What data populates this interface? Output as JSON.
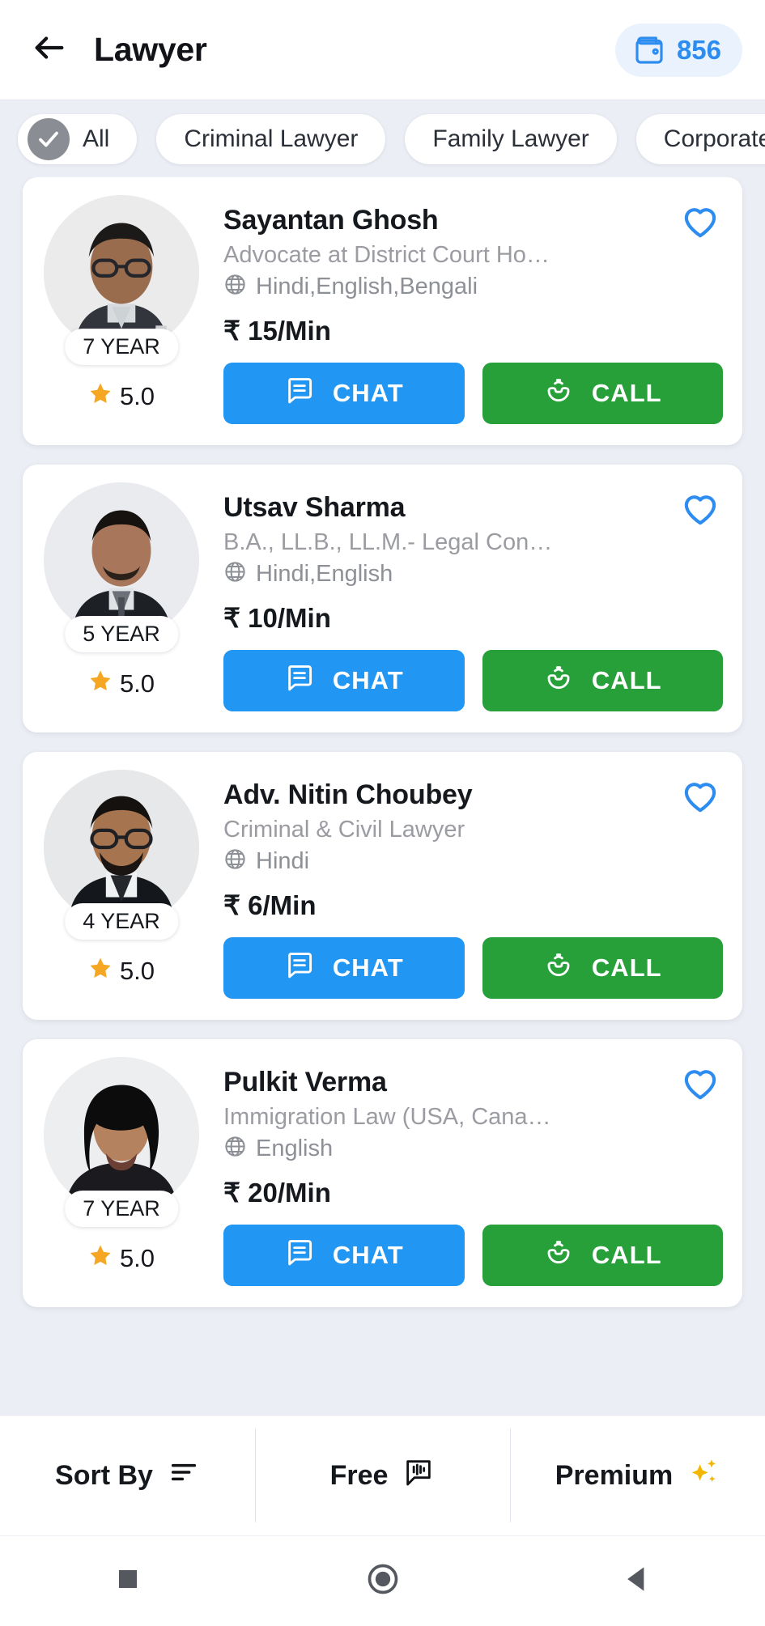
{
  "header": {
    "back_icon": "arrow-left-icon",
    "title": "Lawyer",
    "wallet_icon": "wallet-icon",
    "wallet_balance": "856"
  },
  "filters": {
    "chips": [
      {
        "label": "All",
        "selected": true,
        "icon": "check-icon"
      },
      {
        "label": "Criminal Lawyer",
        "selected": false
      },
      {
        "label": "Family Lawyer",
        "selected": false
      },
      {
        "label": "Corporate Lawyer",
        "selected": false
      }
    ]
  },
  "lawyers": [
    {
      "name": "Sayantan Ghosh",
      "description": "Advocate at District Court Howra…",
      "languages": "Hindi,English,Bengali",
      "price": "₹ 15/Min",
      "experience": "7 YEAR",
      "rating": "5.0",
      "chat_label": "CHAT",
      "call_label": "CALL",
      "favorite_icon": "heart-icon",
      "language_icon": "globe-icon",
      "star_icon": "star-icon"
    },
    {
      "name": "Utsav Sharma",
      "description": "B.A., LL.B., LL.M.- Legal Consulta…",
      "languages": "Hindi,English",
      "price": "₹ 10/Min",
      "experience": "5 YEAR",
      "rating": "5.0",
      "chat_label": "CHAT",
      "call_label": "CALL",
      "favorite_icon": "heart-icon",
      "language_icon": "globe-icon",
      "star_icon": "star-icon"
    },
    {
      "name": "Adv. Nitin Choubey",
      "description": "Criminal & Civil Lawyer",
      "languages": "Hindi",
      "price": "₹ 6/Min",
      "experience": "4 YEAR",
      "rating": "5.0",
      "chat_label": "CHAT",
      "call_label": "CALL",
      "favorite_icon": "heart-icon",
      "language_icon": "globe-icon",
      "star_icon": "star-icon"
    },
    {
      "name": "Pulkit Verma",
      "description": "Immigration Law (USA, Canada, a…",
      "languages": "English",
      "price": "₹ 20/Min",
      "experience": "7 YEAR",
      "rating": "5.0",
      "chat_label": "CHAT",
      "call_label": "CALL",
      "favorite_icon": "heart-icon",
      "language_icon": "globe-icon",
      "star_icon": "star-icon"
    }
  ],
  "bottom_bar": {
    "sort_label": "Sort By",
    "sort_icon": "sort-lines-icon",
    "free_label": "Free",
    "free_icon": "voice-message-icon",
    "premium_label": "Premium",
    "premium_icon": "sparkles-icon"
  },
  "system_nav": {
    "recents_icon": "square-icon",
    "home_icon": "circle-icon",
    "back_icon": "triangle-back-icon"
  },
  "colors": {
    "chat_blue": "#2196f3",
    "call_green": "#27a03a",
    "accent_blue": "#2d8cf0",
    "star_orange": "#f5a623",
    "premium_gold": "#f2b705",
    "page_bg": "#eceef5"
  }
}
